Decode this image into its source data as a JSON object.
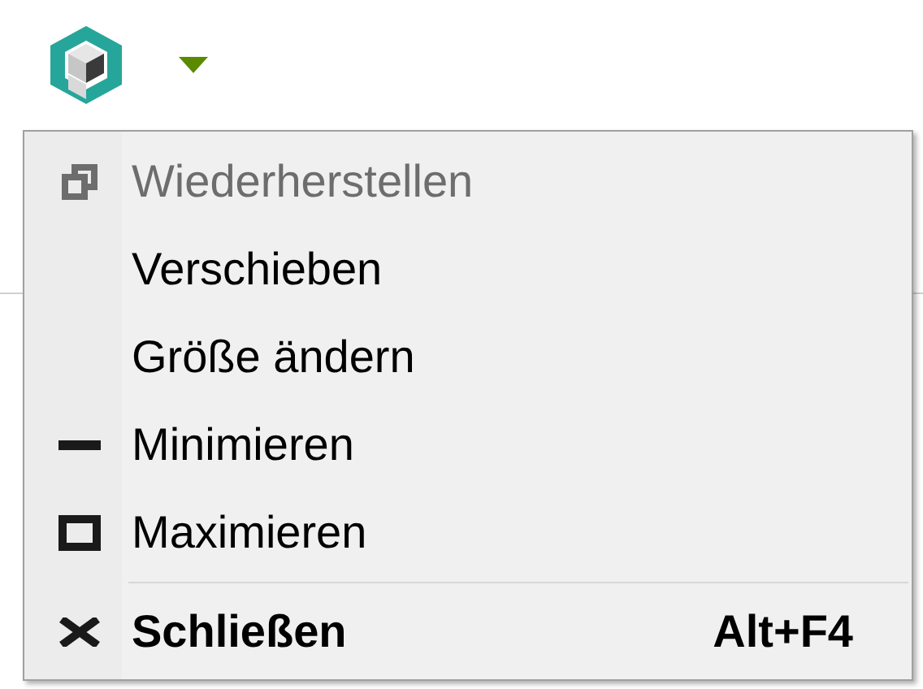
{
  "menu": {
    "items": [
      {
        "kind": "restore",
        "label": "Wiederherstellen",
        "disabled": true,
        "default": false
      },
      {
        "kind": "plain",
        "label": "Verschieben",
        "disabled": false,
        "default": false
      },
      {
        "kind": "plain",
        "label": "Größe ändern",
        "disabled": false,
        "default": false
      },
      {
        "kind": "minimize",
        "label": "Minimieren",
        "disabled": false,
        "default": false
      },
      {
        "kind": "maximize",
        "label": "Maximieren",
        "disabled": false,
        "default": false
      },
      {
        "kind": "separator"
      },
      {
        "kind": "close",
        "label": "Schließen",
        "shortcut": "Alt+F4",
        "disabled": false,
        "default": true
      }
    ]
  }
}
